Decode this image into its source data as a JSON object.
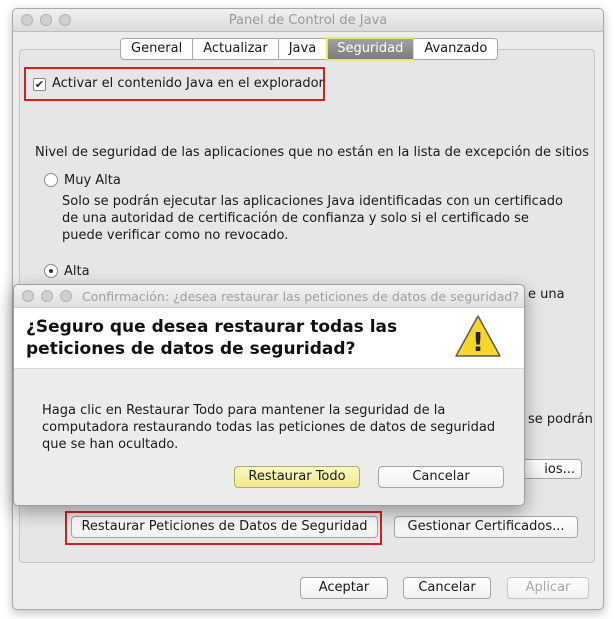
{
  "window": {
    "title": "Panel de Control de Java"
  },
  "tabs": [
    "General",
    "Actualizar",
    "Java",
    "Seguridad",
    "Avanzado"
  ],
  "security": {
    "enable_java_label": "Activar el contenido Java en el explorador",
    "level_heading": "Nivel de seguridad de las aplicaciones que no están en la lista de excepción de sitios",
    "very_high_label": "Muy Alta",
    "very_high_desc": "Solo se podrán ejecutar las aplicaciones Java identificadas con un certificado de una autoridad de certificación de confianza y solo si el certificado se puede verificar como no revocado.",
    "high_label": "Alta",
    "partial_1": "e una",
    "partial_2": "se podrán",
    "partial_3": "ios...",
    "restore_button": "Restaurar Peticiones de Datos de Seguridad",
    "certificates_button": "Gestionar Certificados..."
  },
  "footer": {
    "ok": "Aceptar",
    "cancel": "Cancelar",
    "apply": "Aplicar"
  },
  "dialog": {
    "title": "Confirmación: ¿desea restaurar las peticiones de datos de seguridad?",
    "heading": "¿Seguro que desea restaurar todas las peticiones de datos de seguridad?",
    "body": "Haga clic en Restaurar Todo para mantener la seguridad de la computadora restaurando todas las peticiones de datos de seguridad que se han ocultado.",
    "restore_all": "Restaurar Todo",
    "cancel": "Cancelar"
  },
  "icons": {
    "checkmark": "✔",
    "warning": "!"
  },
  "colors": {
    "highlight_red": "#d42020",
    "tab_active_outline": "#e3e86c",
    "default_button": "#eee88a"
  }
}
